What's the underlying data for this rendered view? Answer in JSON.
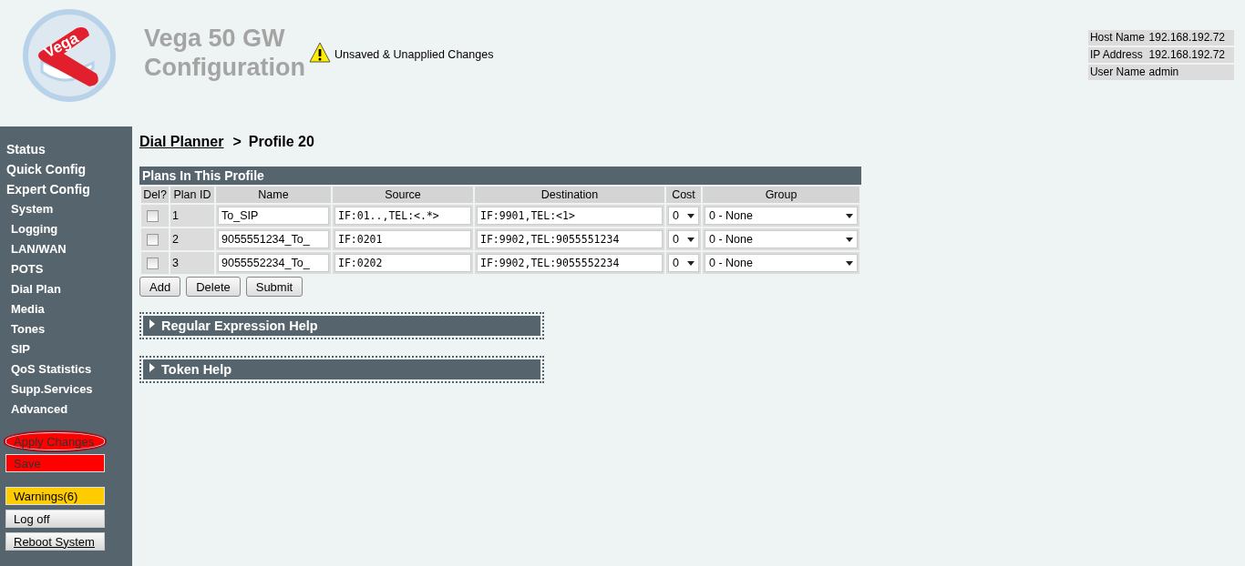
{
  "logo": {
    "text": "Vega"
  },
  "header": {
    "title_line1": "Vega 50 GW",
    "title_line2": "Configuration",
    "warning": "Unsaved & Unapplied Changes"
  },
  "info": [
    {
      "label": "Host Name",
      "value": "192.168.192.72"
    },
    {
      "label": "IP Address",
      "value": "192.168.192.72"
    },
    {
      "label": "User Name",
      "value": "admin"
    }
  ],
  "sidebar": {
    "items": [
      {
        "label": "Status",
        "kind": "main"
      },
      {
        "label": "Quick Config",
        "kind": "main"
      },
      {
        "label": "Expert Config",
        "kind": "main"
      },
      {
        "label": "System",
        "kind": "sub"
      },
      {
        "label": "Logging",
        "kind": "sub"
      },
      {
        "label": "LAN/WAN",
        "kind": "sub"
      },
      {
        "label": "POTS",
        "kind": "sub"
      },
      {
        "label": "Dial Plan",
        "kind": "sub"
      },
      {
        "label": "Media",
        "kind": "sub"
      },
      {
        "label": "Tones",
        "kind": "sub"
      },
      {
        "label": "SIP",
        "kind": "sub"
      },
      {
        "label": "QoS Statistics",
        "kind": "sub"
      },
      {
        "label": "Supp.Services",
        "kind": "sub"
      },
      {
        "label": "Advanced",
        "kind": "sub"
      }
    ],
    "buttons": [
      {
        "label": "Apply Changes",
        "kind": "apply",
        "highlighted": true
      },
      {
        "label": "Save",
        "kind": "save",
        "highlighted": false
      },
      {
        "label": "Warnings(6)",
        "kind": "warning",
        "highlighted": false
      },
      {
        "label": "Log off",
        "kind": "normal",
        "highlighted": false
      },
      {
        "label": "Reboot System",
        "kind": "underlined",
        "highlighted": false
      }
    ]
  },
  "breadcrumb": {
    "link": "Dial Planner",
    "separator": ">",
    "current": "Profile 20"
  },
  "table": {
    "title": "Plans In This Profile",
    "columns": [
      "Del?",
      "Plan ID",
      "Name",
      "Source",
      "Destination",
      "Cost",
      "Group"
    ],
    "rows": [
      {
        "checked": false,
        "plan_id": "1",
        "name": "To_SIP",
        "source": "IF:01..,TEL:<.*>",
        "destination": "IF:9901,TEL:<1>",
        "cost": "0",
        "group": "0 - None"
      },
      {
        "checked": false,
        "plan_id": "2",
        "name": "9055551234_To_",
        "source": "IF:0201",
        "destination": "IF:9902,TEL:9055551234",
        "cost": "0",
        "group": "0 - None"
      },
      {
        "checked": false,
        "plan_id": "3",
        "name": "9055552234_To_",
        "source": "IF:0202",
        "destination": "IF:9902,TEL:9055552234",
        "cost": "0",
        "group": "0 - None"
      }
    ]
  },
  "actions": [
    "Add",
    "Delete",
    "Submit"
  ],
  "help_sections": [
    {
      "title": "Regular Expression Help",
      "expanded": false
    },
    {
      "title": "Token Help",
      "expanded": false
    }
  ]
}
